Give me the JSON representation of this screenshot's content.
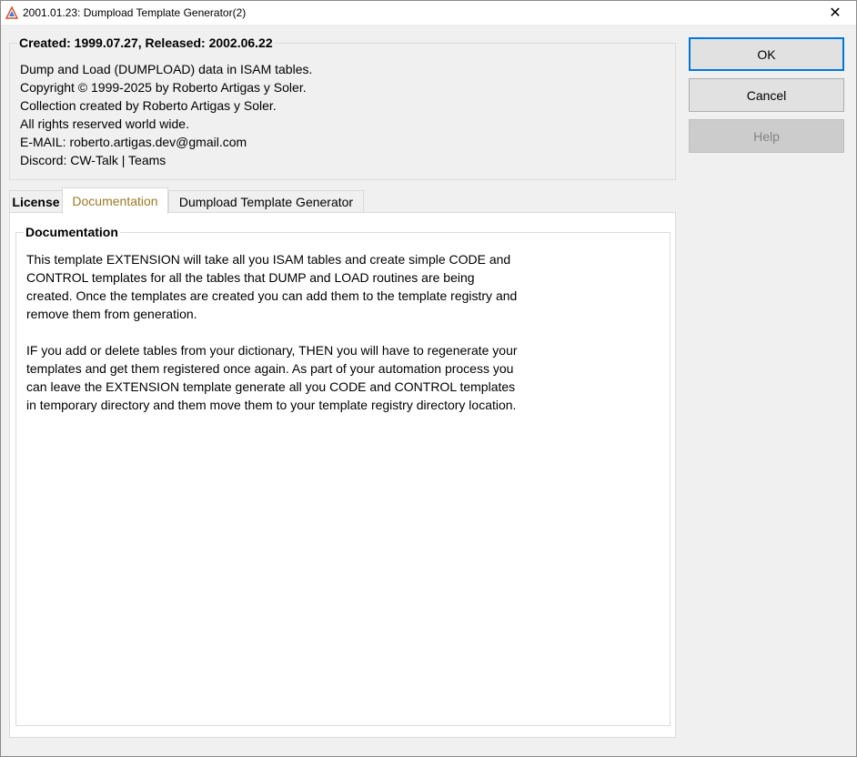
{
  "window": {
    "title": "2001.01.23: Dumpload Template Generator(2)",
    "close_glyph": "✕"
  },
  "info": {
    "legend": "Created: 1999.07.27, Released: 2002.06.22",
    "lines": [
      "Dump and Load (DUMPLOAD) data in ISAM tables.",
      "Copyright © 1999-2025 by Roberto Artigas y Soler.",
      "Collection created by Roberto Artigas y Soler.",
      "All rights reserved world wide.",
      "E-MAIL: roberto.artigas.dev@gmail.com",
      "Discord: CW-Talk | Teams"
    ]
  },
  "buttons": {
    "ok": "OK",
    "cancel": "Cancel",
    "help": "Help"
  },
  "tabs": [
    {
      "label": "License",
      "active": false
    },
    {
      "label": "Documentation",
      "active": true
    },
    {
      "label": "Dumpload Template Generator",
      "active": false
    }
  ],
  "documentation": {
    "legend": "Documentation",
    "paragraphs": [
      "This template EXTENSION will take all you ISAM tables and create simple CODE and CONTROL templates for all the tables that DUMP and LOAD routines are being created. Once the templates are created you can add them to the template registry and remove them from generation.",
      "IF you add or delete tables from your dictionary, THEN you will have to regenerate your templates and get them registered once again. As part of your automation process you can leave the EXTENSION template generate all you CODE and CONTROL templates in temporary directory and them move them to your template registry directory location."
    ]
  },
  "colors": {
    "active_tab_text": "#9c7a27",
    "ok_border": "#0078d7"
  }
}
